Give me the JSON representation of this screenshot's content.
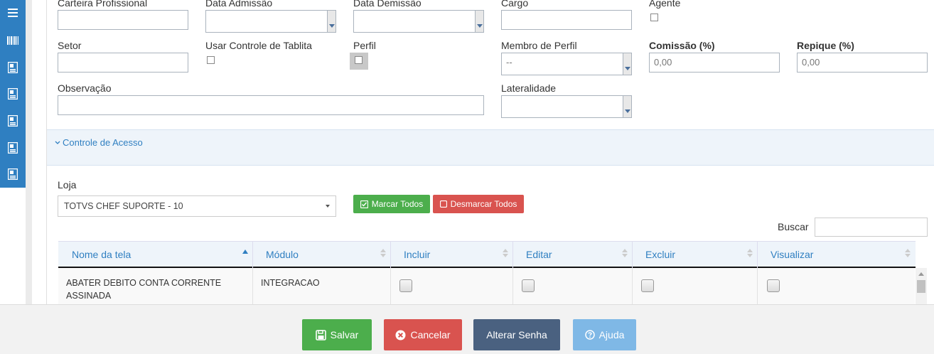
{
  "form": {
    "row1": {
      "carteira_label": "Carteira Profissional",
      "admissao_label": "Data Admissão",
      "demissao_label": "Data Demissão",
      "cargo_label": "Cargo",
      "agente_label": "Agente"
    },
    "row2": {
      "setor_label": "Setor",
      "tablita_label": "Usar Controle de Tablita",
      "perfil_label": "Perfil",
      "membro_label": "Membro de Perfil",
      "membro_value": "--",
      "comissao_label": "Comissão (%)",
      "comissao_value": "0,00",
      "repique_label": "Repique (%)",
      "repique_value": "0,00"
    },
    "row3": {
      "observacao_label": "Observação",
      "lateralidade_label": "Lateralidade"
    }
  },
  "access": {
    "section_title": "Controle de Acesso",
    "loja_label": "Loja",
    "loja_value": "TOTVS CHEF SUPORTE - 10",
    "marcar_label": "Marcar Todos",
    "desmarcar_label": "Desmarcar Todos",
    "buscar_label": "Buscar",
    "colors": {
      "green": "#4cae4c",
      "red": "#d9534f",
      "blue": "#2f7fc1"
    }
  },
  "table": {
    "headers": [
      "Nome da tela",
      "Módulo",
      "Incluir",
      "Editar",
      "Excluir",
      "Visualizar"
    ],
    "rows": [
      {
        "nome_line1": "ABATER DEBITO CONTA CORRENTE",
        "nome_line2": "ASSINADA",
        "modulo": "INTEGRACAO"
      }
    ]
  },
  "footer": {
    "salvar": "Salvar",
    "cancelar": "Cancelar",
    "alterar_senha": "Alterar Senha",
    "ajuda": "Ajuda",
    "colors": {
      "salvar": "#4cae4c",
      "cancelar": "#d9534f",
      "alterar": "#4a6180",
      "ajuda": "#7fb8e6"
    }
  },
  "sidebar": {
    "icons": [
      "menu-icon",
      "barcode-icon",
      "report-icon",
      "report-icon",
      "report-icon",
      "report-icon",
      "report-icon"
    ]
  }
}
